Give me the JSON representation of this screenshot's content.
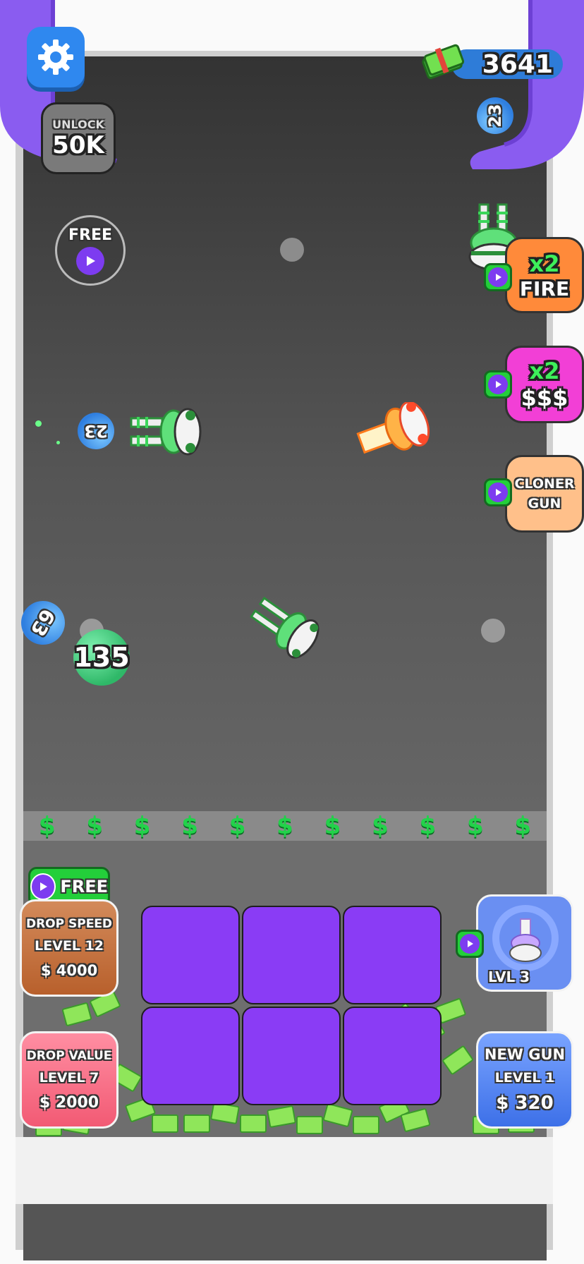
{
  "hud": {
    "money": "3641",
    "unlock_label": "UNLOCK",
    "unlock_cost": "50K"
  },
  "arena": {
    "free_button_label": "FREE",
    "balls": [
      {
        "value": "23",
        "color": "#2f7fe0"
      },
      {
        "value": "23",
        "color": "#2f7fe0"
      },
      {
        "value": "63",
        "color": "#2f7fe0"
      },
      {
        "value": "135",
        "color": "#2fb868"
      }
    ]
  },
  "powerups": {
    "fire": {
      "line1": "x2",
      "line2": "FIRE",
      "color": "#ff8a3a"
    },
    "money": {
      "line1": "x2",
      "line2": "$$$",
      "color": "#f23fd6"
    },
    "cloner": {
      "line1": "CLONER",
      "line2": "GUN",
      "color": "#ffc08a"
    }
  },
  "strip": {
    "symbols": [
      "$",
      "$",
      "$",
      "$",
      "$",
      "$",
      "$",
      "$",
      "$",
      "$",
      "$"
    ]
  },
  "upgrades": {
    "free_badge_label": "FREE",
    "drop_speed": {
      "title": "DROP SPEED",
      "level": "LEVEL 12",
      "price": "$ 4000"
    },
    "drop_value": {
      "title": "DROP VALUE",
      "level": "LEVEL 7",
      "price": "$ 2000"
    },
    "new_gun": {
      "title": "NEW GUN",
      "level": "LEVEL 1",
      "price": "$ 320"
    },
    "gun_preview": {
      "level": "LVL 3"
    }
  },
  "colors": {
    "purple_pipe": "#8a5cf0",
    "grid_purple": "#8a3cf5",
    "accent_green": "#23cf3a"
  },
  "icons": [
    "gear-icon",
    "cash-icon",
    "play-icon",
    "dollar-icon",
    "turret-icon"
  ]
}
